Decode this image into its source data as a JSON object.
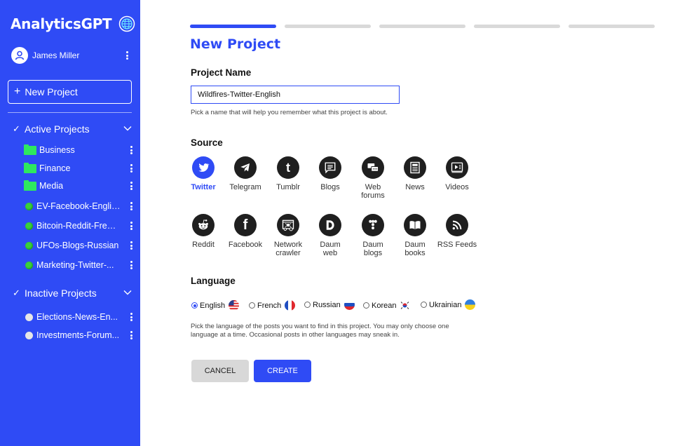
{
  "brand": {
    "name": "AnalyticsGPT"
  },
  "user": {
    "name": "James Miller"
  },
  "sidebar": {
    "new_project_label": "New Project",
    "active_heading": "Active Projects",
    "folders": [
      "Business",
      "Finance",
      "Media"
    ],
    "active_projects": [
      "EV-Facebook-English",
      "Bitcoin-Reddit-French",
      "UFOs-Blogs-Russian",
      "Marketing-Twitter-..."
    ],
    "inactive_heading": "Inactive Projects",
    "inactive_projects": [
      "Elections-News-En...",
      "Investments-Forum..."
    ]
  },
  "wizard": {
    "total_steps": 5,
    "current_step": 1
  },
  "form": {
    "title": "New Project",
    "project_name_label": "Project Name",
    "project_name_value": "Wildfires-Twitter-English",
    "project_name_help": "Pick a name that will help you remember what this project is about.",
    "source_label": "Source",
    "sources": [
      {
        "label": "Twitter",
        "icon": "twitter-icon",
        "selected": true
      },
      {
        "label": "Telegram",
        "icon": "telegram-icon"
      },
      {
        "label": "Tumblr",
        "icon": "tumblr-icon"
      },
      {
        "label": "Blogs",
        "icon": "blogs-icon"
      },
      {
        "label": "Web forums",
        "icon": "web-forums-icon"
      },
      {
        "label": "News",
        "icon": "news-icon"
      },
      {
        "label": "Videos",
        "icon": "videos-icon"
      },
      {
        "label": "Reddit",
        "icon": "reddit-icon"
      },
      {
        "label": "Facebook",
        "icon": "facebook-icon"
      },
      {
        "label": "Network crawler",
        "icon": "network-crawler-icon"
      },
      {
        "label": "Daum web",
        "icon": "daum-web-icon"
      },
      {
        "label": "Daum blogs",
        "icon": "daum-blogs-icon"
      },
      {
        "label": "Daum books",
        "icon": "daum-books-icon"
      },
      {
        "label": "RSS Feeds",
        "icon": "rss-icon"
      }
    ],
    "language_label": "Language",
    "languages": [
      {
        "label": "English",
        "selected": true
      },
      {
        "label": "French"
      },
      {
        "label": "Russian"
      },
      {
        "label": "Korean"
      },
      {
        "label": "Ukrainian"
      }
    ],
    "language_help": "Pick the language of the posts you want to find in this project. You may only choose one language at a time. Occasional posts in other languages may sneak in.",
    "cancel_label": "CANCEL",
    "create_label": "CREATE"
  },
  "colors": {
    "accent": "#2f4bf5",
    "active_dot": "#3ad13a",
    "folder": "#2ee85f"
  }
}
